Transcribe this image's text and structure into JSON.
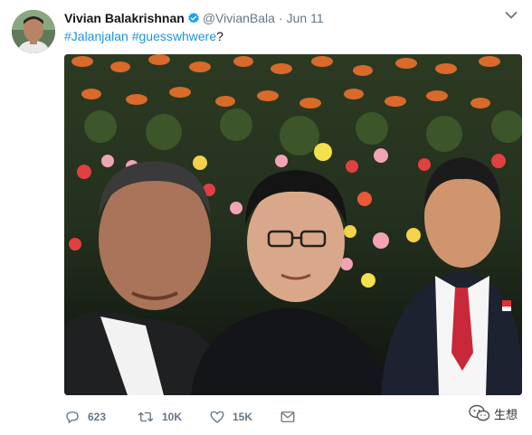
{
  "tweet": {
    "display_name": "Vivian Balakrishnan",
    "handle": "@VivianBala",
    "separator": "·",
    "date": "Jun 11",
    "hashtag_1": "#Jalanjalan",
    "space": " ",
    "hashtag_2": "#guesswhwere",
    "suffix": "?"
  },
  "actions": {
    "replies": "623",
    "retweets": "10K",
    "likes": "15K"
  },
  "watermark": {
    "label": "生想"
  },
  "icons": {
    "avatar": "avatar",
    "verified": "verified-badge-icon",
    "more": "chevron-down-icon",
    "reply": "reply-icon",
    "retweet": "retweet-icon",
    "like": "heart-icon",
    "dm": "envelope-icon",
    "wechat": "wechat-icon"
  },
  "colors": {
    "link": "#1b95e0",
    "muted": "#657786",
    "verified": "#1da1f2"
  }
}
